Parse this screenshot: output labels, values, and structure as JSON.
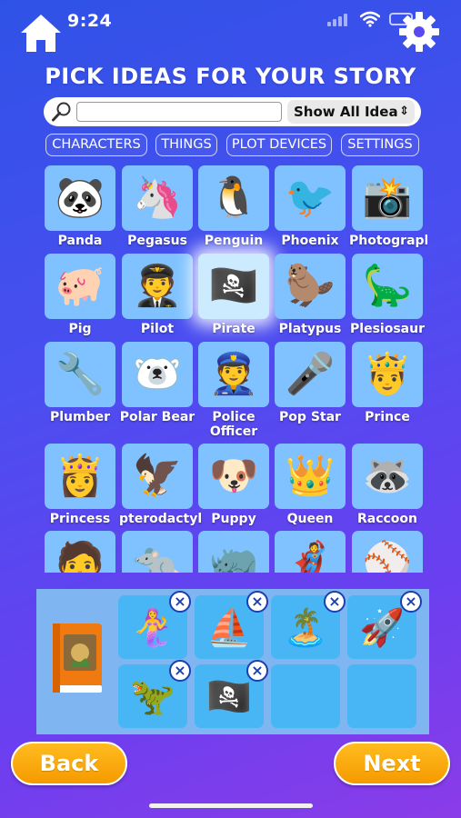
{
  "status": {
    "time": "9:24"
  },
  "header": {
    "title": "PICK IDEAS FOR YOUR STORY"
  },
  "search": {
    "placeholder": "",
    "value": "",
    "filter": "Show All Idea"
  },
  "tabs": [
    {
      "label": "CHARACTERS"
    },
    {
      "label": "THINGS"
    },
    {
      "label": "PLOT DEVICES"
    },
    {
      "label": "SETTINGS"
    }
  ],
  "ideas": [
    {
      "label": "Panda",
      "icon": "🐼"
    },
    {
      "label": "Pegasus",
      "icon": "🦄"
    },
    {
      "label": "Penguin",
      "icon": "🐧"
    },
    {
      "label": "Phoenix",
      "icon": "🐦"
    },
    {
      "label": "Photograph",
      "icon": "📸"
    },
    {
      "label": "Pig",
      "icon": "🐖"
    },
    {
      "label": "Pilot",
      "icon": "🧑‍✈️"
    },
    {
      "label": "Pirate",
      "icon": "🏴‍☠️"
    },
    {
      "label": "Platypus",
      "icon": "🦫"
    },
    {
      "label": "Plesiosaur",
      "icon": "🦕"
    },
    {
      "label": "Plumber",
      "icon": "🔧"
    },
    {
      "label": "Polar Bear",
      "icon": "🐻‍❄️"
    },
    {
      "label": "Police Officer",
      "icon": "👮"
    },
    {
      "label": "Pop Star",
      "icon": "🎤"
    },
    {
      "label": "Prince",
      "icon": "🤴"
    },
    {
      "label": "Princess",
      "icon": "👸"
    },
    {
      "label": "pterodactyl",
      "icon": "🦅"
    },
    {
      "label": "Puppy",
      "icon": "🐶"
    },
    {
      "label": "Queen",
      "icon": "👑"
    },
    {
      "label": "Raccoon",
      "icon": "🦝"
    },
    {
      "label": "",
      "icon": "🧑"
    },
    {
      "label": "",
      "icon": "🐀"
    },
    {
      "label": "",
      "icon": "🦏"
    },
    {
      "label": "",
      "icon": "🦸"
    },
    {
      "label": "",
      "icon": "⚾"
    }
  ],
  "selected": [
    {
      "icon": "🧜‍♀️"
    },
    {
      "icon": "⛵"
    },
    {
      "icon": "🏝️"
    },
    {
      "icon": "🚀"
    },
    {
      "icon": "🦖"
    },
    {
      "icon": "🏴‍☠️"
    },
    {
      "icon": ""
    },
    {
      "icon": ""
    }
  ],
  "footer": {
    "back": "Back",
    "next": "Next"
  },
  "colors": {
    "tile": "#7fc2ff",
    "tray": "#7fb6f2",
    "slot": "#48b6f4",
    "button": "#f8a30a"
  }
}
